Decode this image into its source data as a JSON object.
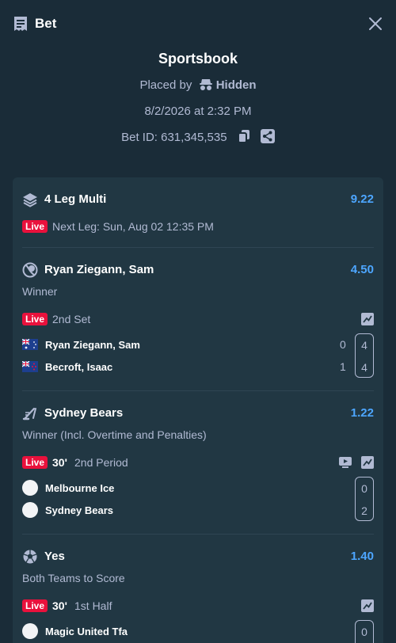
{
  "header": {
    "title": "Bet",
    "icon": "receipt-icon",
    "close_icon": "close-icon"
  },
  "summary": {
    "book": "Sportsbook",
    "placed_by_label": "Placed by",
    "placed_by_user": "Hidden",
    "datetime": "8/2/2026 at 2:32 PM",
    "bet_id": "Bet ID: 631,345,535"
  },
  "multi": {
    "title": "4 Leg Multi",
    "odds": "9.22",
    "live_label": "Live",
    "next_leg": "Next Leg: Sun, Aug 02 12:35 PM"
  },
  "legs": [
    {
      "selection": "Ryan Ziegann, Sam",
      "odds": "4.50",
      "market": "Winner",
      "live_label": "Live",
      "status": "2nd Set",
      "sport_icon": "tennis-ball-icon",
      "teams": [
        {
          "name": "Ryan Ziegann, Sam",
          "score": "0",
          "current": "4",
          "flag": "australia-flag-icon"
        },
        {
          "name": "Becroft, Isaac",
          "score": "1",
          "current": "4",
          "flag": "new-zealand-flag-icon"
        }
      ]
    },
    {
      "selection": "Sydney Bears",
      "odds": "1.22",
      "market": "Winner (Incl. Overtime and Penalties)",
      "live_label": "Live",
      "clock": "30'",
      "status": "2nd Period",
      "sport_icon": "ice-hockey-icon",
      "teams": [
        {
          "name": "Melbourne Ice",
          "current": "0"
        },
        {
          "name": "Sydney Bears",
          "current": "2"
        }
      ]
    },
    {
      "selection": "Yes",
      "odds": "1.40",
      "market": "Both Teams to Score",
      "live_label": "Live",
      "clock": "30'",
      "status": "1st Half",
      "sport_icon": "soccer-ball-icon",
      "teams": [
        {
          "name": "Magic United Tfa",
          "current": "0"
        }
      ]
    }
  ],
  "colors": {
    "background": "#1a2c38",
    "card": "#213743",
    "odds": "#4da6ff",
    "live": "#e9113c"
  }
}
